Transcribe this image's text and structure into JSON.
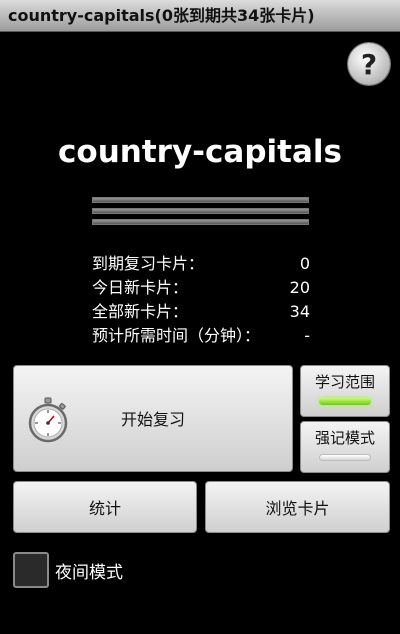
{
  "titlebar": {
    "title": "country-capitals(0张到期共34张卡片)"
  },
  "help": {
    "glyph": "?"
  },
  "deck": {
    "name": "country-capitals"
  },
  "progress": {
    "bars": 3
  },
  "stats": [
    {
      "label": "到期复习卡片：",
      "value": "0"
    },
    {
      "label": "今日新卡片：",
      "value": "20"
    },
    {
      "label": "全部新卡片：",
      "value": "34"
    },
    {
      "label": "预计所需时间（分钟）：",
      "value": "-"
    }
  ],
  "buttons": {
    "start_review": "开始复习",
    "study_scope": "学习范围",
    "cram_mode": "强记模式",
    "statistics": "统计",
    "browse_cards": "浏览卡片"
  },
  "toggles": {
    "study_scope_on": true,
    "cram_mode_on": false
  },
  "night_mode": {
    "label": "夜间模式",
    "checked": false
  },
  "icons": {
    "help": "help-question-icon",
    "review": "stopwatch-icon"
  },
  "colors": {
    "background": "#000000",
    "indicator_on": "#8fe03a",
    "indicator_off": "#e8e8e8"
  }
}
